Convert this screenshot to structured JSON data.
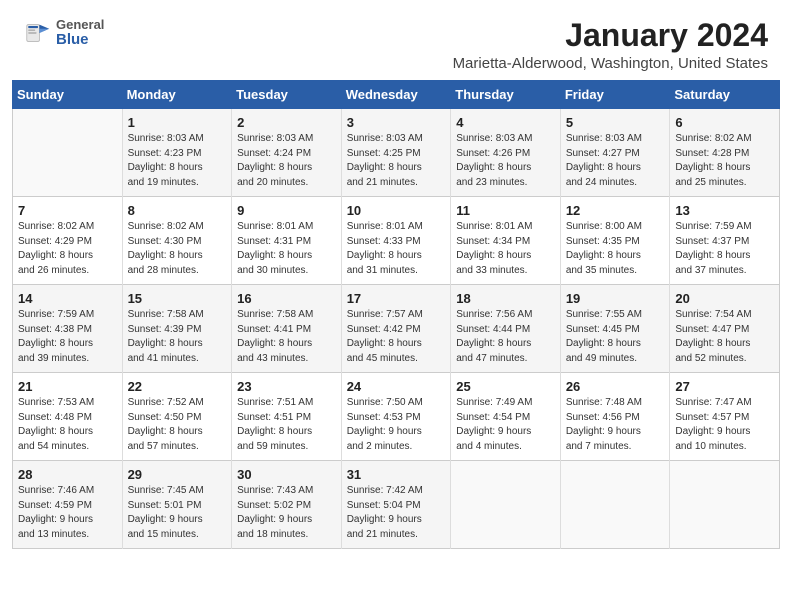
{
  "header": {
    "logo_general": "General",
    "logo_blue": "Blue",
    "month_year": "January 2024",
    "location": "Marietta-Alderwood, Washington, United States"
  },
  "weekdays": [
    "Sunday",
    "Monday",
    "Tuesday",
    "Wednesday",
    "Thursday",
    "Friday",
    "Saturday"
  ],
  "weeks": [
    [
      {
        "day": "",
        "info": ""
      },
      {
        "day": "1",
        "info": "Sunrise: 8:03 AM\nSunset: 4:23 PM\nDaylight: 8 hours\nand 19 minutes."
      },
      {
        "day": "2",
        "info": "Sunrise: 8:03 AM\nSunset: 4:24 PM\nDaylight: 8 hours\nand 20 minutes."
      },
      {
        "day": "3",
        "info": "Sunrise: 8:03 AM\nSunset: 4:25 PM\nDaylight: 8 hours\nand 21 minutes."
      },
      {
        "day": "4",
        "info": "Sunrise: 8:03 AM\nSunset: 4:26 PM\nDaylight: 8 hours\nand 23 minutes."
      },
      {
        "day": "5",
        "info": "Sunrise: 8:03 AM\nSunset: 4:27 PM\nDaylight: 8 hours\nand 24 minutes."
      },
      {
        "day": "6",
        "info": "Sunrise: 8:02 AM\nSunset: 4:28 PM\nDaylight: 8 hours\nand 25 minutes."
      }
    ],
    [
      {
        "day": "7",
        "info": "Sunrise: 8:02 AM\nSunset: 4:29 PM\nDaylight: 8 hours\nand 26 minutes."
      },
      {
        "day": "8",
        "info": "Sunrise: 8:02 AM\nSunset: 4:30 PM\nDaylight: 8 hours\nand 28 minutes."
      },
      {
        "day": "9",
        "info": "Sunrise: 8:01 AM\nSunset: 4:31 PM\nDaylight: 8 hours\nand 30 minutes."
      },
      {
        "day": "10",
        "info": "Sunrise: 8:01 AM\nSunset: 4:33 PM\nDaylight: 8 hours\nand 31 minutes."
      },
      {
        "day": "11",
        "info": "Sunrise: 8:01 AM\nSunset: 4:34 PM\nDaylight: 8 hours\nand 33 minutes."
      },
      {
        "day": "12",
        "info": "Sunrise: 8:00 AM\nSunset: 4:35 PM\nDaylight: 8 hours\nand 35 minutes."
      },
      {
        "day": "13",
        "info": "Sunrise: 7:59 AM\nSunset: 4:37 PM\nDaylight: 8 hours\nand 37 minutes."
      }
    ],
    [
      {
        "day": "14",
        "info": "Sunrise: 7:59 AM\nSunset: 4:38 PM\nDaylight: 8 hours\nand 39 minutes."
      },
      {
        "day": "15",
        "info": "Sunrise: 7:58 AM\nSunset: 4:39 PM\nDaylight: 8 hours\nand 41 minutes."
      },
      {
        "day": "16",
        "info": "Sunrise: 7:58 AM\nSunset: 4:41 PM\nDaylight: 8 hours\nand 43 minutes."
      },
      {
        "day": "17",
        "info": "Sunrise: 7:57 AM\nSunset: 4:42 PM\nDaylight: 8 hours\nand 45 minutes."
      },
      {
        "day": "18",
        "info": "Sunrise: 7:56 AM\nSunset: 4:44 PM\nDaylight: 8 hours\nand 47 minutes."
      },
      {
        "day": "19",
        "info": "Sunrise: 7:55 AM\nSunset: 4:45 PM\nDaylight: 8 hours\nand 49 minutes."
      },
      {
        "day": "20",
        "info": "Sunrise: 7:54 AM\nSunset: 4:47 PM\nDaylight: 8 hours\nand 52 minutes."
      }
    ],
    [
      {
        "day": "21",
        "info": "Sunrise: 7:53 AM\nSunset: 4:48 PM\nDaylight: 8 hours\nand 54 minutes."
      },
      {
        "day": "22",
        "info": "Sunrise: 7:52 AM\nSunset: 4:50 PM\nDaylight: 8 hours\nand 57 minutes."
      },
      {
        "day": "23",
        "info": "Sunrise: 7:51 AM\nSunset: 4:51 PM\nDaylight: 8 hours\nand 59 minutes."
      },
      {
        "day": "24",
        "info": "Sunrise: 7:50 AM\nSunset: 4:53 PM\nDaylight: 9 hours\nand 2 minutes."
      },
      {
        "day": "25",
        "info": "Sunrise: 7:49 AM\nSunset: 4:54 PM\nDaylight: 9 hours\nand 4 minutes."
      },
      {
        "day": "26",
        "info": "Sunrise: 7:48 AM\nSunset: 4:56 PM\nDaylight: 9 hours\nand 7 minutes."
      },
      {
        "day": "27",
        "info": "Sunrise: 7:47 AM\nSunset: 4:57 PM\nDaylight: 9 hours\nand 10 minutes."
      }
    ],
    [
      {
        "day": "28",
        "info": "Sunrise: 7:46 AM\nSunset: 4:59 PM\nDaylight: 9 hours\nand 13 minutes."
      },
      {
        "day": "29",
        "info": "Sunrise: 7:45 AM\nSunset: 5:01 PM\nDaylight: 9 hours\nand 15 minutes."
      },
      {
        "day": "30",
        "info": "Sunrise: 7:43 AM\nSunset: 5:02 PM\nDaylight: 9 hours\nand 18 minutes."
      },
      {
        "day": "31",
        "info": "Sunrise: 7:42 AM\nSunset: 5:04 PM\nDaylight: 9 hours\nand 21 minutes."
      },
      {
        "day": "",
        "info": ""
      },
      {
        "day": "",
        "info": ""
      },
      {
        "day": "",
        "info": ""
      }
    ]
  ]
}
